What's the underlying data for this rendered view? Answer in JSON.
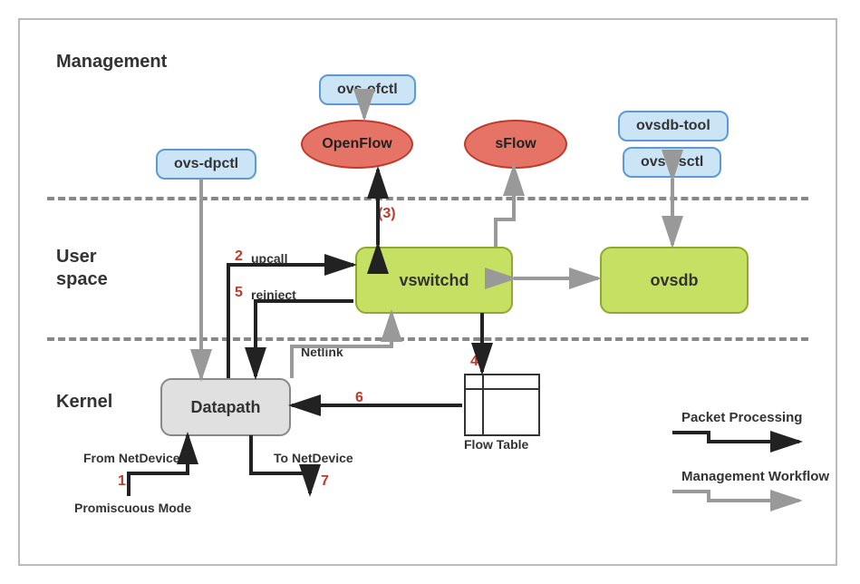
{
  "sections": {
    "management": "Management",
    "userspace_l1": "User",
    "userspace_l2": "space",
    "kernel": "Kernel"
  },
  "boxes": {
    "ovs_dpctl": "ovs-dpctl",
    "ovs_ofctl": "ovs-ofctl",
    "ovsdb_tool": "ovsdb-tool",
    "ovs_vsctl": "ovs-vsctl",
    "openflow": "OpenFlow",
    "sflow": "sFlow",
    "vswitchd": "vswitchd",
    "ovsdb": "ovsdb",
    "datapath": "Datapath",
    "flow_table": "Flow Table"
  },
  "labels": {
    "upcall": "upcall",
    "reinject": "reinject",
    "netlink": "Netlink",
    "from_netdevice": "From NetDevice",
    "to_netdevice": "To NetDevice",
    "promiscuous": "Promiscuous Mode"
  },
  "nums": {
    "n1": "1",
    "n2": "2",
    "n3": "(3)",
    "n4": "4",
    "n5": "5",
    "n6": "6",
    "n7": "7"
  },
  "legend": {
    "packet": "Packet Processing",
    "mgmt": "Management Workflow"
  }
}
